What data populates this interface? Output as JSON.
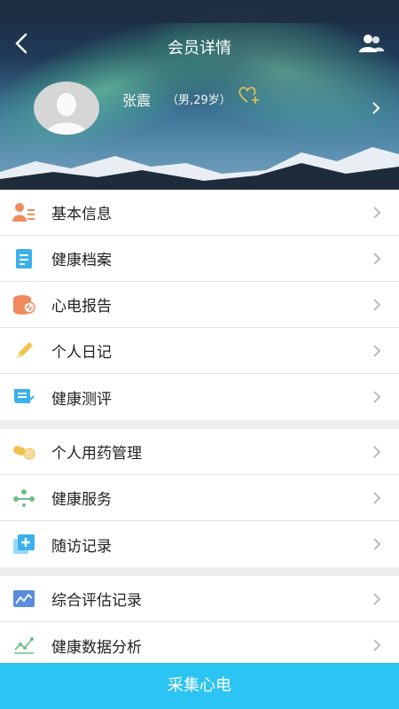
{
  "header": {
    "title": "会员详情"
  },
  "profile": {
    "name": "张震",
    "meta": "（男,29岁）"
  },
  "menu_groups": [
    [
      {
        "label": "基本信息",
        "icon": "person-info-icon"
      },
      {
        "label": "健康档案",
        "icon": "document-icon"
      },
      {
        "label": "心电报告",
        "icon": "ecg-report-icon"
      },
      {
        "label": "个人日记",
        "icon": "pencil-icon"
      },
      {
        "label": "健康测评",
        "icon": "assessment-icon"
      }
    ],
    [
      {
        "label": "个人用药管理",
        "icon": "medicine-icon"
      },
      {
        "label": "健康服务",
        "icon": "service-icon"
      },
      {
        "label": "随访记录",
        "icon": "followup-icon"
      }
    ],
    [
      {
        "label": "综合评估记录",
        "icon": "evaluation-chart-icon"
      },
      {
        "label": "健康数据分析",
        "icon": "data-analysis-icon"
      }
    ]
  ],
  "bottom_button": {
    "label": "采集心电"
  },
  "colors": {
    "accent": "#2cc4f2",
    "orange": "#f08a5d",
    "blue": "#3ab0ec",
    "yellow": "#f1c14e",
    "green": "#6cc18a"
  }
}
